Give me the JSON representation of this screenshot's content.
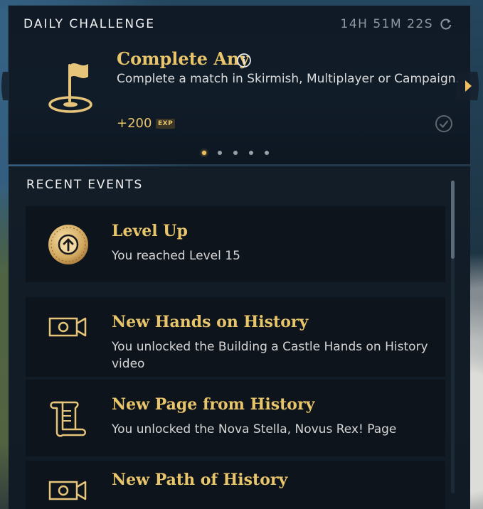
{
  "daily_challenge": {
    "section_title": "DAILY CHALLENGE",
    "timer": "14H 51M 22S",
    "name": "Complete Any",
    "description": "Complete a match in Skirmish, Multiplayer or Campaign.",
    "reward": "+200",
    "reward_unit": "EXP",
    "pager_total": 5,
    "pager_active": 1
  },
  "recent_events": {
    "section_title": "RECENT EVENTS",
    "items": [
      {
        "title": "Level Up",
        "description": "You reached Level 15",
        "icon": "level-up-medallion-icon"
      },
      {
        "title": "New Hands on History",
        "description": "You unlocked the Building a Castle Hands on History video",
        "icon": "video-camera-icon"
      },
      {
        "title": "New Page from History",
        "description": "You unlocked the Nova Stella, Novus Rex! Page",
        "icon": "scroll-icon"
      },
      {
        "title": "New Path of History",
        "description": "",
        "icon": "video-camera-icon"
      }
    ]
  },
  "colors": {
    "gold": "#e8c46a",
    "panel": "#101c28"
  }
}
